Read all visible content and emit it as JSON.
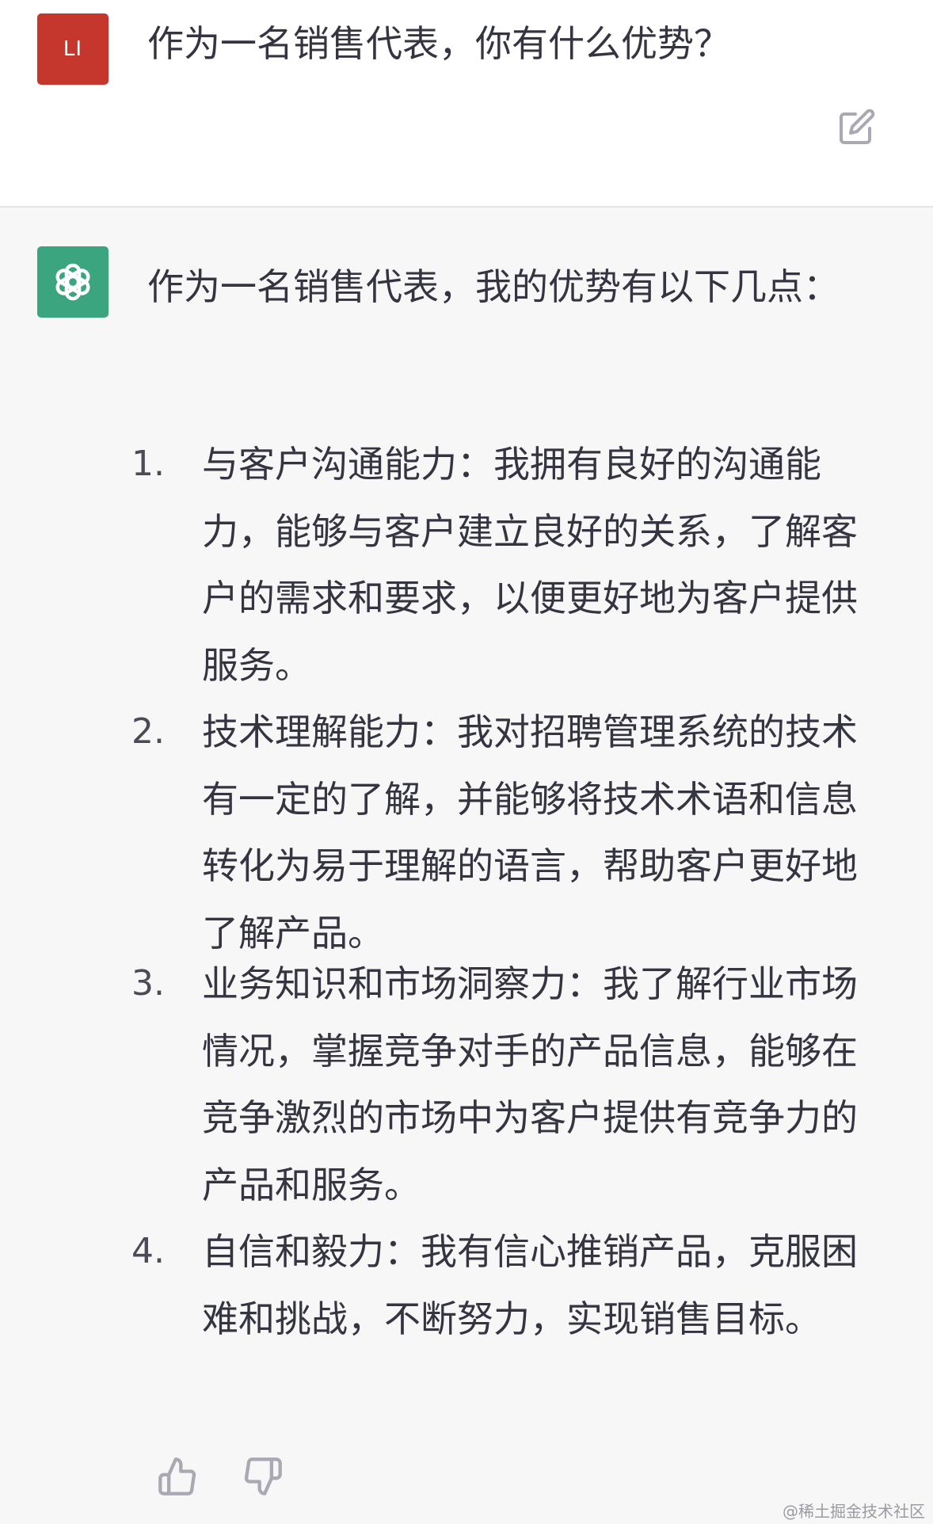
{
  "user": {
    "avatar_text": "LI",
    "question": "作为一名销售代表，你有什么优势？"
  },
  "assistant": {
    "intro": "作为一名销售代表，我的优势有以下几点：",
    "items": [
      {
        "number": "1.",
        "text": "与客户沟通能力：我拥有良好的沟通能力，能够与客户建立良好的关系，了解客户的需求和要求，以便更好地为客户提供服务。"
      },
      {
        "number": "2.",
        "text": "技术理解能力：我对招聘管理系统的技术有一定的了解，并能够将技术术语和信息转化为易于理解的语言，帮助客户更好地了解产品。"
      },
      {
        "number": "3.",
        "text": "业务知识和市场洞察力：我了解行业市场情况，掌握竞争对手的产品信息，能够在竞争激烈的市场中为客户提供有竞争力的产品和服务。"
      },
      {
        "number": "4.",
        "text": "自信和毅力：我有信心推销产品，克服困难和挑战，不断努力，实现销售目标。"
      }
    ]
  },
  "watermark": "@稀土掘金技术社区",
  "colors": {
    "user_avatar_bg": "#c5362c",
    "bot_avatar_bg": "#3aa57e",
    "page_bg": "#f7f7f8",
    "text": "#343541"
  },
  "icons": {
    "bot_avatar": "openai-logo-icon",
    "edit": "edit-icon",
    "like": "thumb-up-icon",
    "dislike": "thumb-down-icon"
  }
}
